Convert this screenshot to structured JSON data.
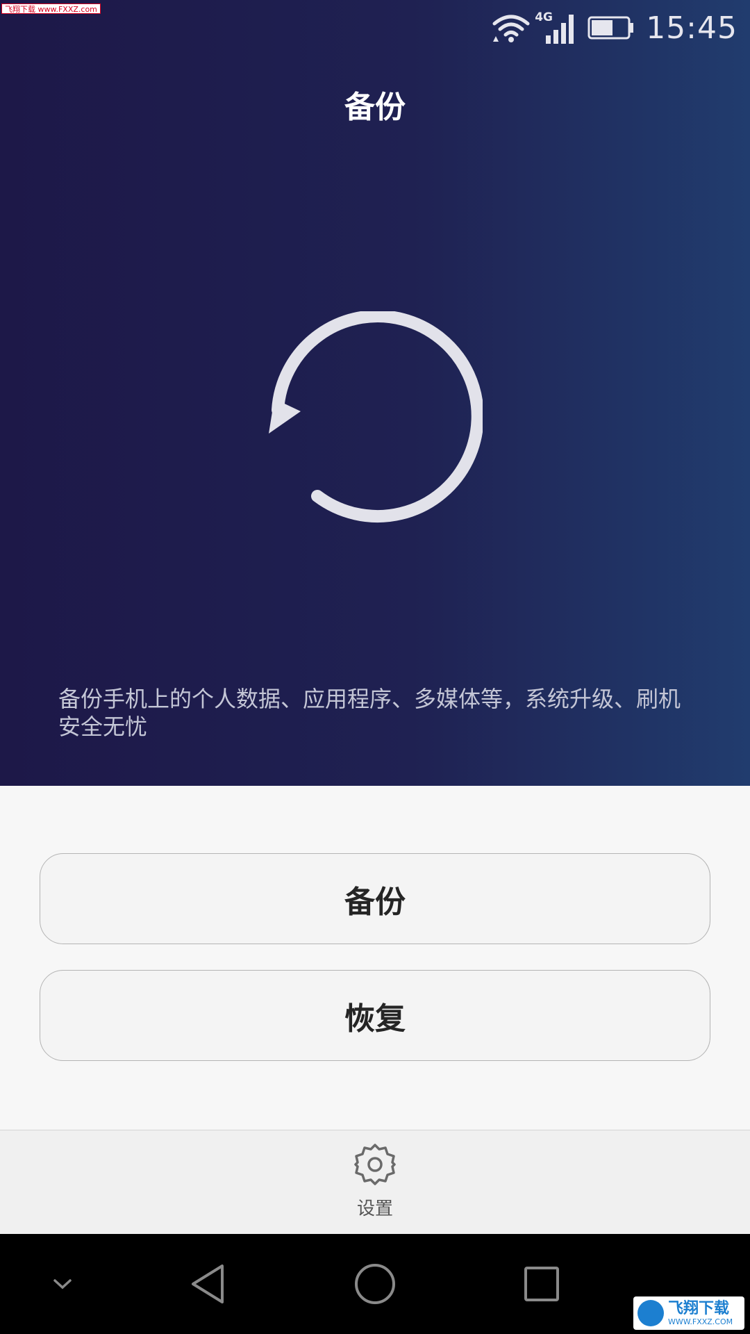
{
  "watermark_top": "飞翔下载 www.FXXZ.com",
  "status_bar": {
    "network": "4G",
    "time": "15:45",
    "battery_level": 0.6
  },
  "header": {
    "title": "备份"
  },
  "description": "备份手机上的个人数据、应用程序、多媒体等，系统升级、刷机安全无忧",
  "actions": {
    "backup_label": "备份",
    "restore_label": "恢复"
  },
  "bottom_bar": {
    "settings_label": "设置"
  },
  "watermark_bottom": {
    "cn": "飞翔下载",
    "en": "WWW.FXXZ.COM"
  },
  "colors": {
    "hero_start": "#1d1848",
    "hero_end": "#213c6e",
    "spinner": "#e2e2ea",
    "button_text": "#252525"
  },
  "icons": {
    "wifi": "wifi-icon",
    "signal": "signal-icon",
    "battery": "battery-icon",
    "spinner": "refresh-arrow-icon",
    "settings": "gear-icon",
    "nav_down": "chevron-down-icon",
    "nav_back": "back-triangle-icon",
    "nav_home": "home-circle-icon",
    "nav_recent": "recent-square-icon"
  }
}
